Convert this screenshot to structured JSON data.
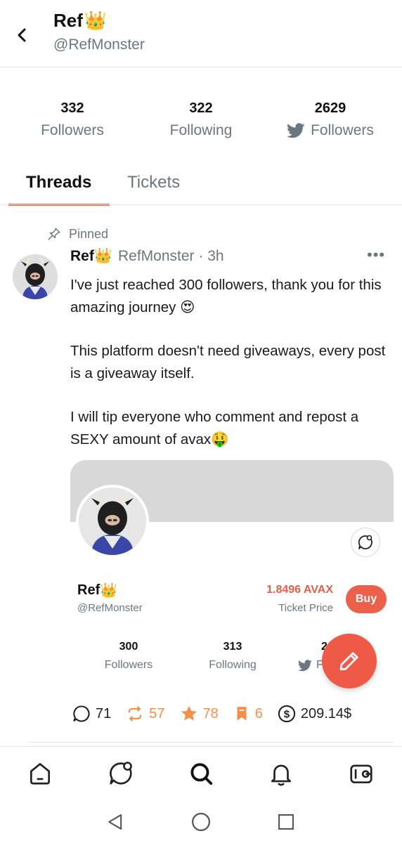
{
  "header": {
    "title": "Ref",
    "title_emoji": "👑",
    "handle": "@RefMonster"
  },
  "stats": [
    {
      "value": "332",
      "label": "Followers"
    },
    {
      "value": "322",
      "label": "Following"
    },
    {
      "value": "2629",
      "label": "Followers",
      "icon": "twitter-icon"
    }
  ],
  "tabs": [
    {
      "label": "Threads",
      "active": true
    },
    {
      "label": "Tickets",
      "active": false
    }
  ],
  "post": {
    "pinned_label": "Pinned",
    "author_name": "Ref",
    "author_emoji": "👑",
    "author_meta": "RefMonster · 3h",
    "more": "•••",
    "paragraphs": [
      "I've just reached 300 followers, thank you for this amazing journey 😍",
      "This platform doesn't need giveaways, every post is a giveaway itself.",
      "I will tip everyone who comment and repost a SEXY amount of avax🤑"
    ],
    "card": {
      "name": "Ref",
      "name_emoji": "👑",
      "handle": "@RefMonster",
      "price": "1.8496 AVAX",
      "price_label": "Ticket Price",
      "buy_label": "Buy",
      "stats": [
        {
          "value": "300",
          "label": "Followers"
        },
        {
          "value": "313",
          "label": "Following"
        },
        {
          "value": "2",
          "label": "F",
          "icon": "twitter-icon"
        }
      ]
    },
    "actions": {
      "comments": "71",
      "reposts": "57",
      "likes": "78",
      "bookmarks": "6",
      "tips": "209.14$"
    }
  },
  "colors": {
    "accent": "#ec5f4a",
    "orange": "#f2904a",
    "muted": "#6b7780",
    "banner": "#d8d8d8"
  },
  "bottom_nav": [
    "home-icon",
    "chat-icon",
    "search-icon",
    "bell-icon",
    "wallet-icon"
  ],
  "system_nav": [
    "back-triangle-icon",
    "home-circle-icon",
    "recents-square-icon"
  ]
}
